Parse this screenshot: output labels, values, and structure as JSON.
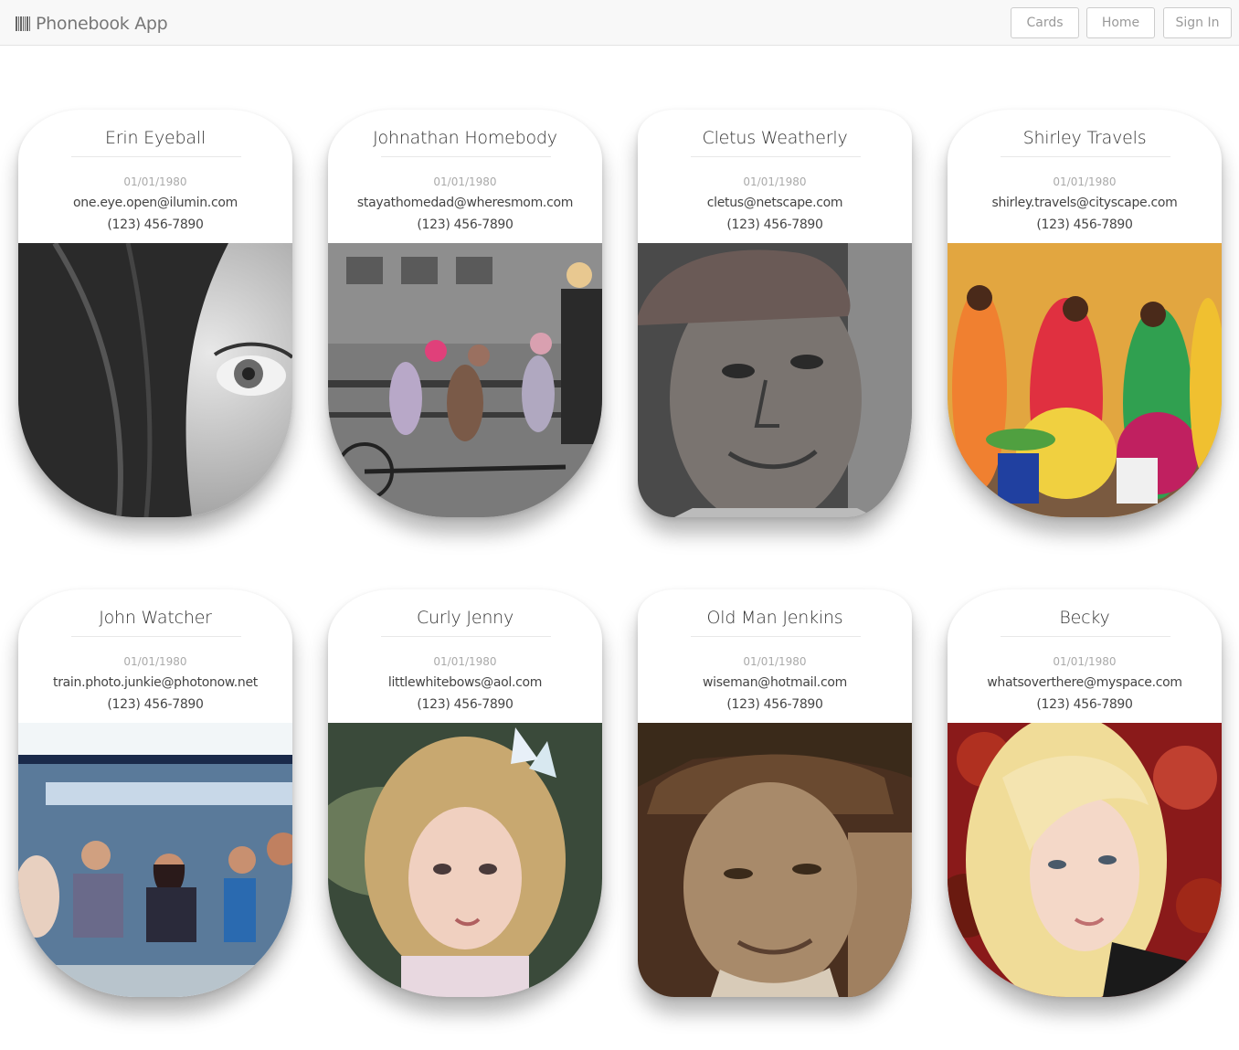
{
  "navbar": {
    "brand": "Phonebook App",
    "brand_icon": "barcode-icon",
    "buttons": {
      "cards": "Cards",
      "home": "Home",
      "sign_in": "Sign In"
    }
  },
  "cards": [
    {
      "name": "Erin Eyeball",
      "dob": "01/01/1980",
      "email": "one.eye.open@ilumin.com",
      "phone": "(123) 456-7890"
    },
    {
      "name": "Johnathan Homebody",
      "dob": "01/01/1980",
      "email": "stayathomedad@wheresmom.com",
      "phone": "(123) 456-7890"
    },
    {
      "name": "Cletus Weatherly",
      "dob": "01/01/1980",
      "email": "cletus@netscape.com",
      "phone": "(123) 456-7890"
    },
    {
      "name": "Shirley Travels",
      "dob": "01/01/1980",
      "email": "shirley.travels@cityscape.com",
      "phone": "(123) 456-7890"
    },
    {
      "name": "John Watcher",
      "dob": "01/01/1980",
      "email": "train.photo.junkie@photonow.net",
      "phone": "(123) 456-7890"
    },
    {
      "name": "Curly Jenny",
      "dob": "01/01/1980",
      "email": "littlewhitebows@aol.com",
      "phone": "(123) 456-7890"
    },
    {
      "name": "Old Man Jenkins",
      "dob": "01/01/1980",
      "email": "wiseman@hotmail.com",
      "phone": "(123) 456-7890"
    },
    {
      "name": "Becky",
      "dob": "01/01/1980",
      "email": "whatsoverthere@myspace.com",
      "phone": "(123) 456-7890"
    }
  ]
}
